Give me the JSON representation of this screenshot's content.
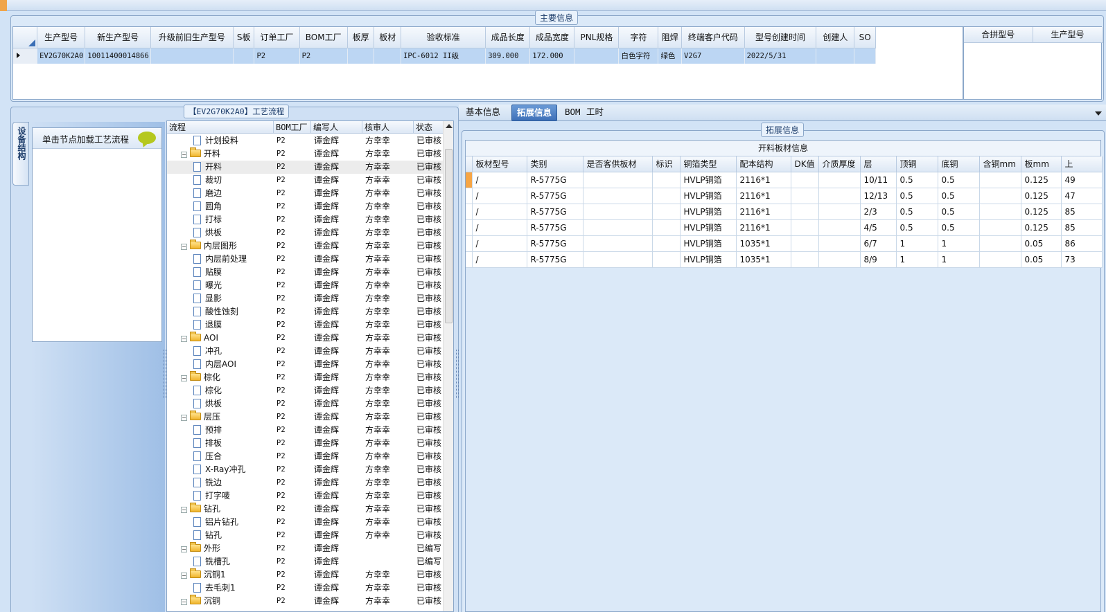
{
  "main_info": {
    "title": "主要信息",
    "columns": [
      "生产型号",
      "新生产型号",
      "升级前旧生产型号",
      "S板",
      "订单工厂",
      "BOM工厂",
      "板厚",
      "板材",
      "验收标准",
      "成品长度",
      "成品宽度",
      "PNL规格",
      "字符",
      "阻焊",
      "终端客户代码",
      "型号创建时间",
      "创建人",
      "SO"
    ],
    "rows": [
      [
        "EV2G70K2A0",
        "10011400014866",
        "",
        "",
        "P2",
        "P2",
        "",
        "",
        "IPC-6012 II级",
        "309.000",
        "172.000",
        "",
        "白色字符",
        "绿色",
        "V2G7",
        "2022/5/31",
        "",
        ""
      ]
    ]
  },
  "merge_grid": {
    "columns": [
      "合拼型号",
      "生产型号"
    ]
  },
  "process_panel": {
    "title": "【EV2G70K2A0】工艺流程",
    "side_tab": "设备结构",
    "load_hint": "单击节点加载工艺流程",
    "tree_columns": [
      "流程",
      "BOM工厂",
      "编写人",
      "核审人",
      "状态"
    ],
    "tree_rows": [
      {
        "level": 2,
        "type": "doc",
        "name": "计划投料",
        "bom": "P2",
        "writer": "谭金辉",
        "reviewer": "方幸幸",
        "status": "已审核"
      },
      {
        "level": 1,
        "type": "folder",
        "name": "开料",
        "bom": "P2",
        "writer": "谭金辉",
        "reviewer": "方幸幸",
        "status": "已审核"
      },
      {
        "level": 2,
        "type": "doc",
        "name": "开料",
        "bom": "P2",
        "writer": "谭金辉",
        "reviewer": "方幸幸",
        "status": "已审核",
        "selected": true
      },
      {
        "level": 2,
        "type": "doc",
        "name": "裁切",
        "bom": "P2",
        "writer": "谭金辉",
        "reviewer": "方幸幸",
        "status": "已审核"
      },
      {
        "level": 2,
        "type": "doc",
        "name": "磨边",
        "bom": "P2",
        "writer": "谭金辉",
        "reviewer": "方幸幸",
        "status": "已审核"
      },
      {
        "level": 2,
        "type": "doc",
        "name": "圆角",
        "bom": "P2",
        "writer": "谭金辉",
        "reviewer": "方幸幸",
        "status": "已审核"
      },
      {
        "level": 2,
        "type": "doc",
        "name": "打标",
        "bom": "P2",
        "writer": "谭金辉",
        "reviewer": "方幸幸",
        "status": "已审核"
      },
      {
        "level": 2,
        "type": "doc",
        "name": "烘板",
        "bom": "P2",
        "writer": "谭金辉",
        "reviewer": "方幸幸",
        "status": "已审核"
      },
      {
        "level": 1,
        "type": "folder",
        "name": "内层图形",
        "bom": "P2",
        "writer": "谭金辉",
        "reviewer": "方幸幸",
        "status": "已审核"
      },
      {
        "level": 2,
        "type": "doc",
        "name": "内层前处理",
        "bom": "P2",
        "writer": "谭金辉",
        "reviewer": "方幸幸",
        "status": "已审核"
      },
      {
        "level": 2,
        "type": "doc",
        "name": "贴膜",
        "bom": "P2",
        "writer": "谭金辉",
        "reviewer": "方幸幸",
        "status": "已审核"
      },
      {
        "level": 2,
        "type": "doc",
        "name": "曝光",
        "bom": "P2",
        "writer": "谭金辉",
        "reviewer": "方幸幸",
        "status": "已审核"
      },
      {
        "level": 2,
        "type": "doc",
        "name": "显影",
        "bom": "P2",
        "writer": "谭金辉",
        "reviewer": "方幸幸",
        "status": "已审核"
      },
      {
        "level": 2,
        "type": "doc",
        "name": "酸性蚀刻",
        "bom": "P2",
        "writer": "谭金辉",
        "reviewer": "方幸幸",
        "status": "已审核"
      },
      {
        "level": 2,
        "type": "doc",
        "name": "退膜",
        "bom": "P2",
        "writer": "谭金辉",
        "reviewer": "方幸幸",
        "status": "已审核"
      },
      {
        "level": 1,
        "type": "folder",
        "name": "AOI",
        "bom": "P2",
        "writer": "谭金辉",
        "reviewer": "方幸幸",
        "status": "已审核"
      },
      {
        "level": 2,
        "type": "doc",
        "name": "冲孔",
        "bom": "P2",
        "writer": "谭金辉",
        "reviewer": "方幸幸",
        "status": "已审核"
      },
      {
        "level": 2,
        "type": "doc",
        "name": "内层AOI",
        "bom": "P2",
        "writer": "谭金辉",
        "reviewer": "方幸幸",
        "status": "已审核"
      },
      {
        "level": 1,
        "type": "folder",
        "name": "棕化",
        "bom": "P2",
        "writer": "谭金辉",
        "reviewer": "方幸幸",
        "status": "已审核"
      },
      {
        "level": 2,
        "type": "doc",
        "name": "棕化",
        "bom": "P2",
        "writer": "谭金辉",
        "reviewer": "方幸幸",
        "status": "已审核"
      },
      {
        "level": 2,
        "type": "doc",
        "name": "烘板",
        "bom": "P2",
        "writer": "谭金辉",
        "reviewer": "方幸幸",
        "status": "已审核"
      },
      {
        "level": 1,
        "type": "folder",
        "name": "层压",
        "bom": "P2",
        "writer": "谭金辉",
        "reviewer": "方幸幸",
        "status": "已审核"
      },
      {
        "level": 2,
        "type": "doc",
        "name": "预排",
        "bom": "P2",
        "writer": "谭金辉",
        "reviewer": "方幸幸",
        "status": "已审核"
      },
      {
        "level": 2,
        "type": "doc",
        "name": "排板",
        "bom": "P2",
        "writer": "谭金辉",
        "reviewer": "方幸幸",
        "status": "已审核"
      },
      {
        "level": 2,
        "type": "doc",
        "name": "压合",
        "bom": "P2",
        "writer": "谭金辉",
        "reviewer": "方幸幸",
        "status": "已审核"
      },
      {
        "level": 2,
        "type": "doc",
        "name": "X-Ray冲孔",
        "bom": "P2",
        "writer": "谭金辉",
        "reviewer": "方幸幸",
        "status": "已审核"
      },
      {
        "level": 2,
        "type": "doc",
        "name": "铣边",
        "bom": "P2",
        "writer": "谭金辉",
        "reviewer": "方幸幸",
        "status": "已审核"
      },
      {
        "level": 2,
        "type": "doc",
        "name": "打字唛",
        "bom": "P2",
        "writer": "谭金辉",
        "reviewer": "方幸幸",
        "status": "已审核"
      },
      {
        "level": 1,
        "type": "folder",
        "name": "钻孔",
        "bom": "P2",
        "writer": "谭金辉",
        "reviewer": "方幸幸",
        "status": "已审核"
      },
      {
        "level": 2,
        "type": "doc",
        "name": "铝片钻孔",
        "bom": "P2",
        "writer": "谭金辉",
        "reviewer": "方幸幸",
        "status": "已审核"
      },
      {
        "level": 2,
        "type": "doc",
        "name": "钻孔",
        "bom": "P2",
        "writer": "谭金辉",
        "reviewer": "方幸幸",
        "status": "已审核"
      },
      {
        "level": 1,
        "type": "folder",
        "name": "外形",
        "bom": "P2",
        "writer": "谭金辉",
        "reviewer": "",
        "status": "已编写"
      },
      {
        "level": 2,
        "type": "doc",
        "name": "铣槽孔",
        "bom": "P2",
        "writer": "谭金辉",
        "reviewer": "",
        "status": "已编写"
      },
      {
        "level": 1,
        "type": "folder",
        "name": "沉铜1",
        "bom": "P2",
        "writer": "谭金辉",
        "reviewer": "方幸幸",
        "status": "已审核"
      },
      {
        "level": 2,
        "type": "doc",
        "name": "去毛刺1",
        "bom": "P2",
        "writer": "谭金辉",
        "reviewer": "方幸幸",
        "status": "已审核"
      },
      {
        "level": 1,
        "type": "folder",
        "name": "沉铜",
        "bom": "P2",
        "writer": "谭金辉",
        "reviewer": "方幸幸",
        "status": "已审核"
      }
    ]
  },
  "tabs": [
    "基本信息",
    "拓展信息",
    "BOM",
    "工时"
  ],
  "active_tab": "拓展信息",
  "ext_info": {
    "title": "拓展信息",
    "table_title": "开料板材信息",
    "columns": [
      "板材型号",
      "类别",
      "是否客供板材",
      "标识",
      "铜箔类型",
      "配本结构",
      "DK值",
      "介质厚度",
      "层",
      "顶铜",
      "底铜",
      "含铜mm",
      "板mm",
      "上"
    ],
    "rows": [
      [
        "/",
        "R-5775G",
        "",
        "",
        "HVLP铜箔",
        "2116*1",
        "",
        "",
        "10/11",
        "0.5",
        "0.5",
        "",
        "0.125",
        "49"
      ],
      [
        "/",
        "R-5775G",
        "",
        "",
        "HVLP铜箔",
        "2116*1",
        "",
        "",
        "12/13",
        "0.5",
        "0.5",
        "",
        "0.125",
        "47"
      ],
      [
        "/",
        "R-5775G",
        "",
        "",
        "HVLP铜箔",
        "2116*1",
        "",
        "",
        "2/3",
        "0.5",
        "0.5",
        "",
        "0.125",
        "85"
      ],
      [
        "/",
        "R-5775G",
        "",
        "",
        "HVLP铜箔",
        "2116*1",
        "",
        "",
        "4/5",
        "0.5",
        "0.5",
        "",
        "0.125",
        "85"
      ],
      [
        "/",
        "R-5775G",
        "",
        "",
        "HVLP铜箔",
        "1035*1",
        "",
        "",
        "6/7",
        "1",
        "1",
        "",
        "0.05",
        "86"
      ],
      [
        "/",
        "R-5775G",
        "",
        "",
        "HVLP铜箔",
        "1035*1",
        "",
        "",
        "8/9",
        "1",
        "1",
        "",
        "0.05",
        "73"
      ]
    ]
  },
  "colors": {
    "row_selected": "#bcd6f3",
    "tab_active": "#4a7cc2",
    "frame": "#8ba7c9",
    "row_marker": "#f6a545"
  }
}
